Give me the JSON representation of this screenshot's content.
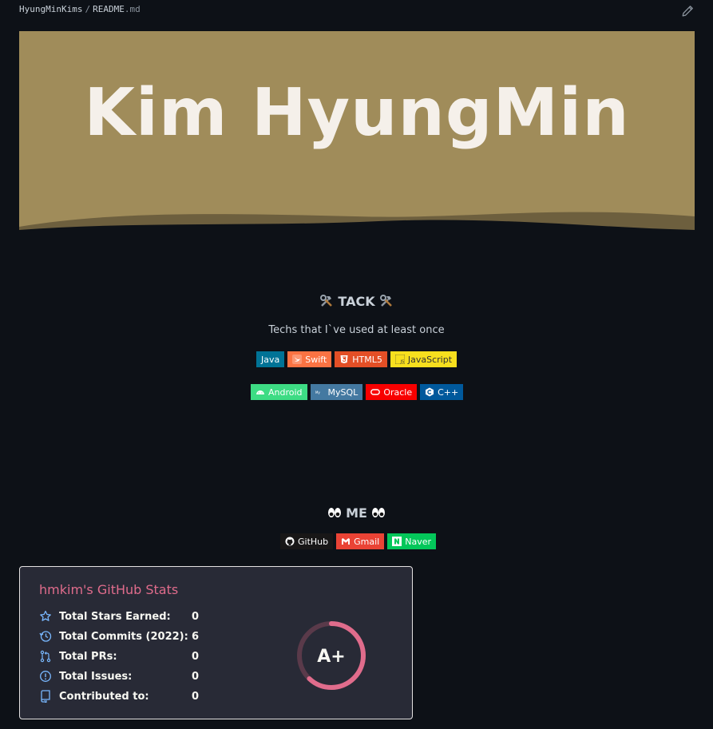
{
  "breadcrumb": {
    "owner": "HyungMinKims",
    "separator": "/",
    "file": "README",
    "ext": ".md"
  },
  "banner": {
    "title": "Kim HyungMin",
    "bg": "#a08c5a",
    "wave": "#6d5f3e"
  },
  "tack": {
    "heading": "TACK",
    "subtitle": "Techs that I`ve used at least once"
  },
  "badges_row1": [
    {
      "label": "Java",
      "color": "#007396",
      "icon": "java-icon"
    },
    {
      "label": "Swift",
      "color": "#fa7343",
      "icon": "swift-icon"
    },
    {
      "label": "HTML5",
      "color": "#e34f26",
      "icon": "html5-icon"
    },
    {
      "label": "JavaScript",
      "color": "#f7df1e",
      "icon": "javascript-icon"
    }
  ],
  "badges_row2": [
    {
      "label": "Android",
      "color": "#3ddc84",
      "icon": "android-icon"
    },
    {
      "label": "MySQL",
      "color": "#4479a1",
      "icon": "mysql-icon"
    },
    {
      "label": "Oracle",
      "color": "#f80000",
      "icon": "oracle-icon"
    },
    {
      "label": "C++",
      "color": "#00599c",
      "icon": "cplusplus-icon"
    }
  ],
  "me": {
    "heading": "ME"
  },
  "contact_badges": [
    {
      "label": "GitHub",
      "color": "#181717",
      "icon": "github-icon"
    },
    {
      "label": "Gmail",
      "color": "#ea4335",
      "icon": "gmail-icon"
    },
    {
      "label": "Naver",
      "color": "#03c75a",
      "icon": "naver-icon"
    }
  ],
  "stats": {
    "title": "hmkim's GitHub Stats",
    "rows": [
      {
        "label": "Total Stars Earned:",
        "value": "0",
        "icon": "star-icon"
      },
      {
        "label": "Total Commits (2022):",
        "value": "6",
        "icon": "history-icon"
      },
      {
        "label": "Total PRs:",
        "value": "0",
        "icon": "pull-request-icon"
      },
      {
        "label": "Total Issues:",
        "value": "0",
        "icon": "issue-icon"
      },
      {
        "label": "Contributed to:",
        "value": "0",
        "icon": "repo-icon"
      }
    ],
    "grade": "A+",
    "grade_progress": 0.62,
    "accent": "#e06c8c",
    "icon_color": "#79b8ff"
  }
}
